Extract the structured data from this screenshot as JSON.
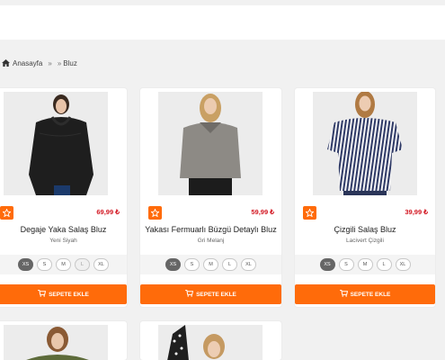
{
  "breadcrumb": {
    "home_label": "Anasayfa",
    "separator": "»",
    "current": "Bluz"
  },
  "colors": {
    "accent": "#ff6b0a",
    "price": "#d2141f",
    "background": "#f1f1f1"
  },
  "products": [
    {
      "title": "Degaje Yaka Salaş Bluz",
      "color": "Yeni Siyah",
      "price": "69,99 ₺",
      "sizes": [
        "XS",
        "S",
        "M",
        "L",
        "XL"
      ],
      "selected_size": "XS",
      "cart_label": "SEPETE EKLE"
    },
    {
      "title": "Yakası Fermuarlı Büzgü Detaylı Bluz",
      "color": "Gri Melanj",
      "price": "59,99 ₺",
      "sizes": [
        "XS",
        "S",
        "M",
        "L",
        "XL"
      ],
      "selected_size": "XS",
      "cart_label": "SEPETE EKLE"
    },
    {
      "title": "Çizgili Salaş Bluz",
      "color": "Lacivert Çizgili",
      "price": "39,99 ₺",
      "sizes": [
        "XS",
        "S",
        "M",
        "L",
        "XL"
      ],
      "selected_size": "XS",
      "cart_label": "SEPETE EKLE"
    }
  ],
  "icons": {
    "home": "home-icon",
    "favorite": "star-icon",
    "cart": "cart-icon"
  }
}
